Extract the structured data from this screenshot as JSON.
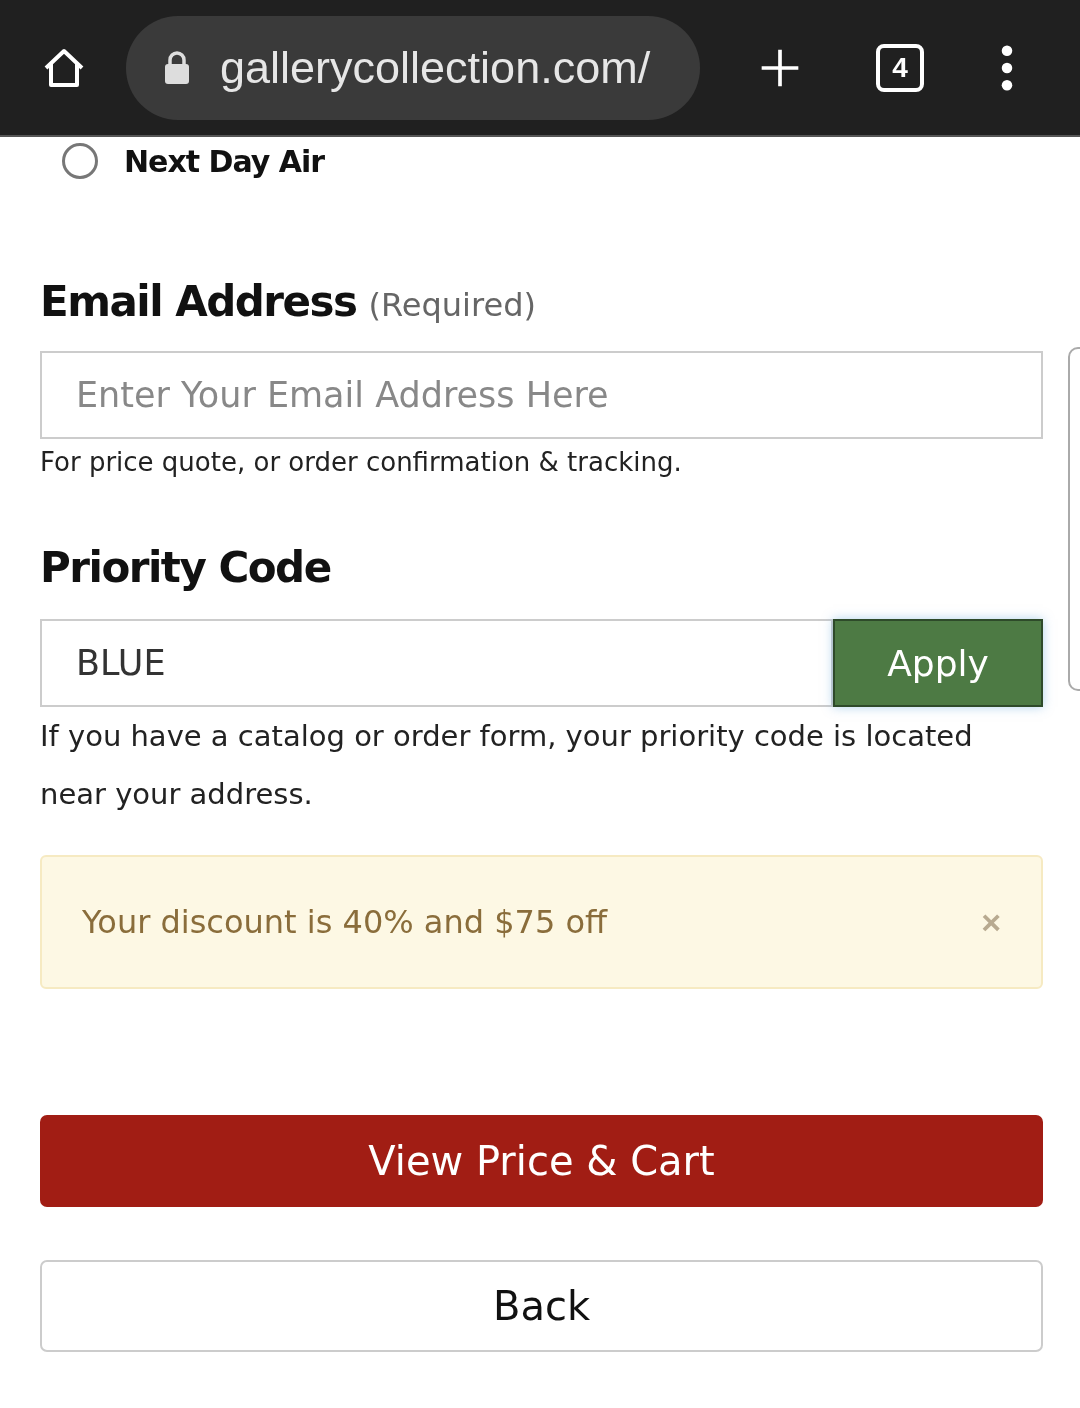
{
  "browser": {
    "url": "gallerycollection.com/",
    "tab_count": "4"
  },
  "shipping_option": {
    "label": "Next Day Air",
    "selected": false
  },
  "email": {
    "label": "Email Address",
    "note": "(Required)",
    "placeholder": "Enter Your Email Address Here",
    "help": "For price quote, or order confirmation & tracking."
  },
  "priority_code": {
    "label": "Priority Code",
    "value": "BLUE",
    "button": "Apply",
    "help": "If you have a catalog or order form, your priority code is located near your address."
  },
  "alert": {
    "message": "Your discount is 40% and $75 off",
    "close": "×"
  },
  "buttons": [
    {
      "kind": "primary",
      "label": "View Price & Cart"
    },
    {
      "kind": "secondary",
      "label": "Back"
    }
  ]
}
